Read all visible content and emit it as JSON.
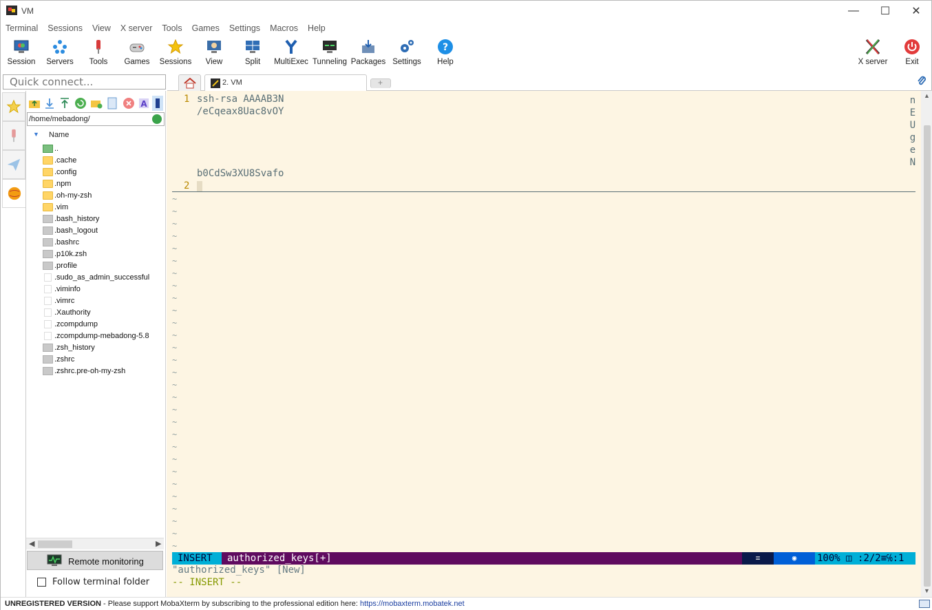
{
  "window": {
    "title": "VM"
  },
  "menu": [
    "Terminal",
    "Sessions",
    "View",
    "X server",
    "Tools",
    "Games",
    "Settings",
    "Macros",
    "Help"
  ],
  "toolbar": {
    "session": "Session",
    "servers": "Servers",
    "tools": "Tools",
    "games": "Games",
    "sessions": "Sessions",
    "view": "View",
    "split": "Split",
    "multiexec": "MultiExec",
    "tunneling": "Tunneling",
    "packages": "Packages",
    "settings": "Settings",
    "help": "Help",
    "xserver": "X server",
    "exit": "Exit"
  },
  "quick_connect": {
    "placeholder": "Quick connect..."
  },
  "tabs": {
    "active": "2. VM"
  },
  "sftp": {
    "path": "/home/mebadong/",
    "column": "Name",
    "files": [
      {
        "name": "..",
        "type": "up"
      },
      {
        "name": ".cache",
        "type": "folder"
      },
      {
        "name": ".config",
        "type": "folder"
      },
      {
        "name": ".npm",
        "type": "folder"
      },
      {
        "name": ".oh-my-zsh",
        "type": "folder"
      },
      {
        "name": ".vim",
        "type": "folder"
      },
      {
        "name": ".bash_history",
        "type": "file"
      },
      {
        "name": ".bash_logout",
        "type": "file"
      },
      {
        "name": ".bashrc",
        "type": "file"
      },
      {
        "name": ".p10k.zsh",
        "type": "file"
      },
      {
        "name": ".profile",
        "type": "file"
      },
      {
        "name": ".sudo_as_admin_successful",
        "type": "blank"
      },
      {
        "name": ".viminfo",
        "type": "blank"
      },
      {
        "name": ".vimrc",
        "type": "blank"
      },
      {
        "name": ".Xauthority",
        "type": "blank"
      },
      {
        "name": ".zcompdump",
        "type": "blank"
      },
      {
        "name": ".zcompdump-mebadong-5.8",
        "type": "blank"
      },
      {
        "name": ".zsh_history",
        "type": "file"
      },
      {
        "name": ".zshrc",
        "type": "file"
      },
      {
        "name": ".zshrc.pre-oh-my-zsh",
        "type": "file"
      }
    ],
    "remote_monitoring": "Remote monitoring",
    "follow_folder": "Follow terminal folder"
  },
  "terminal": {
    "line1_num": "1",
    "line1_a": "ssh-rsa AAAAB3N",
    "line1_b": "/eCqeax8Uac8vOY",
    "line1_c": "b0CdSw3XU8Svafo",
    "line2_num": "2",
    "side_chars": [
      "n",
      "E",
      "U",
      "g",
      "e",
      "N"
    ],
    "tilde": "~",
    "status": {
      "mode": "INSERT",
      "file": "authorized_keys[+]",
      "zoom": "100%",
      "pos": ":2/2≡℅:1"
    },
    "message": "\"authorized_keys\" [New]",
    "insert_mode": "-- INSERT --"
  },
  "footer": {
    "unregistered": "UNREGISTERED VERSION",
    "message": " -  Please support MobaXterm by subscribing to the professional edition here: ",
    "link": "https://mobaxterm.mobatek.net"
  }
}
